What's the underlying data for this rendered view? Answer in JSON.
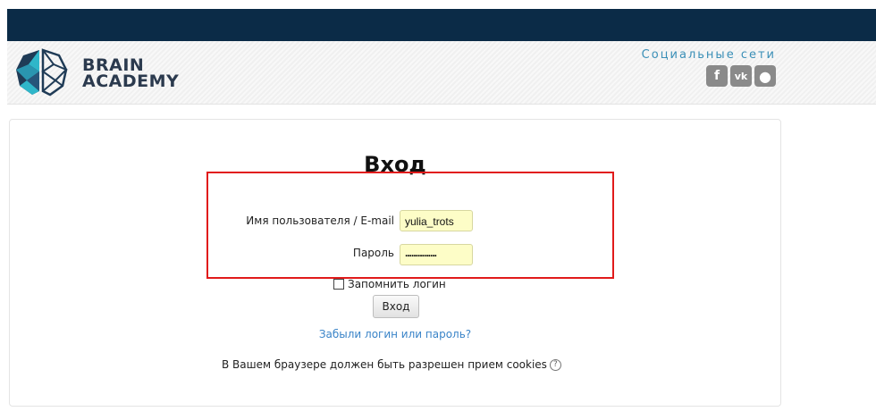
{
  "brand": {
    "line1": "BRAIN",
    "line2": "ACADEMY",
    "colors": {
      "topbar": "#0b2b47",
      "logo_dark": "#1f3b56",
      "logo_teal": "#2fb6c9"
    }
  },
  "social": {
    "title": "Социальные сети",
    "icons": [
      {
        "name": "facebook-icon",
        "glyph": "f"
      },
      {
        "name": "vk-icon",
        "glyph": "vk"
      },
      {
        "name": "globe-icon",
        "glyph": "●"
      }
    ]
  },
  "login": {
    "title": "Вход",
    "username_label": "Имя пользователя / E-mail",
    "username_value": "yulia_trots",
    "password_label": "Пароль",
    "password_value": "...............",
    "remember_label": "Запомнить логин",
    "submit_label": "Вход",
    "forgot_link": "Забыли логин или пароль?",
    "cookies_note": "В Вашем браузере должен быть разрешен прием cookies",
    "help_glyph": "?"
  }
}
